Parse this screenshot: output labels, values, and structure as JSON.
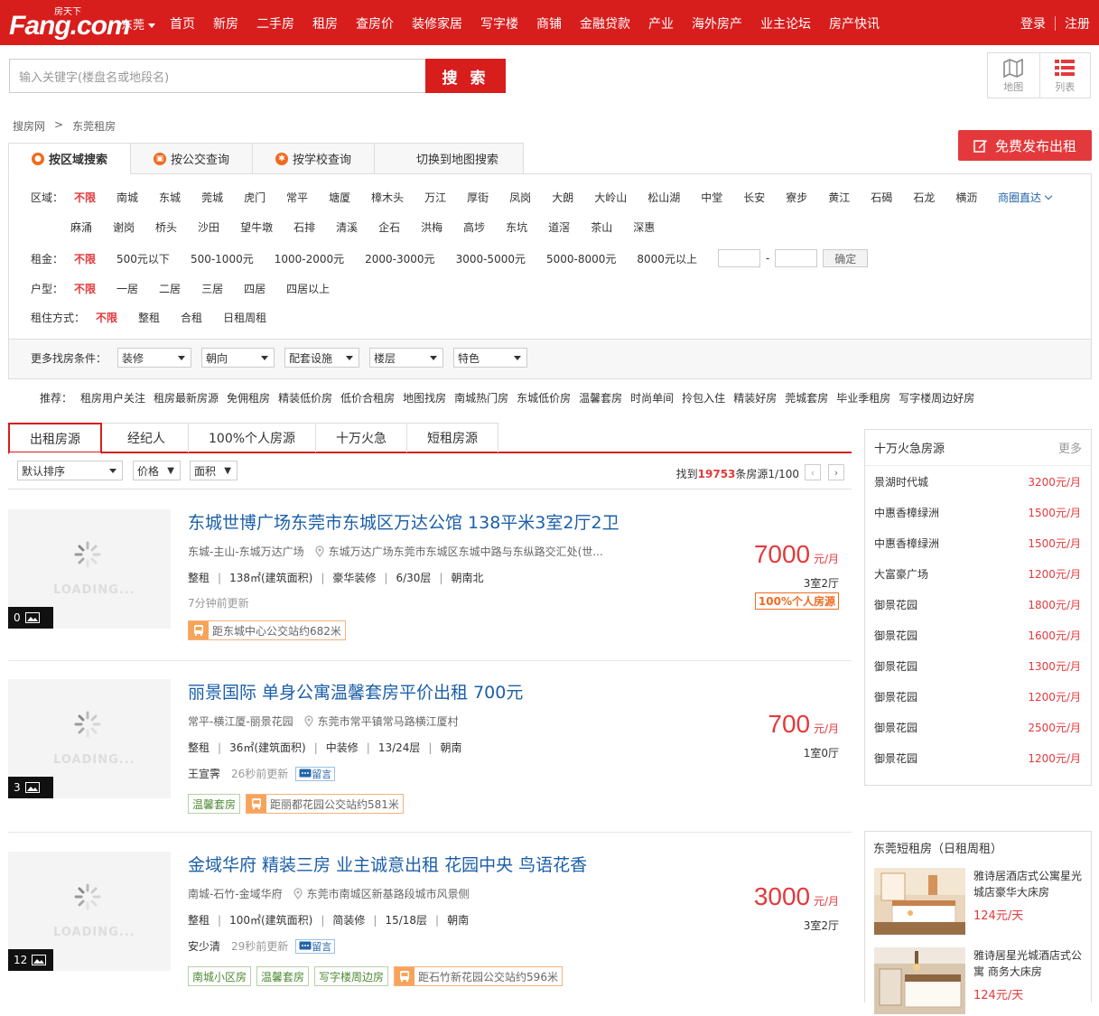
{
  "header": {
    "logo_text": "Fang.com",
    "logo_cn": "房天下",
    "city": "东莞",
    "nav": [
      "首页",
      "新房",
      "二手房",
      "租房",
      "查房价",
      "装修家居",
      "写字楼",
      "商铺",
      "金融贷款",
      "产业",
      "海外房产",
      "业主论坛",
      "房产快讯"
    ],
    "login": "登录",
    "register": "注册"
  },
  "search": {
    "placeholder": "输入关键字(楼盘名或地段名)",
    "button": "搜 索"
  },
  "view_switch": {
    "map": "地图",
    "list": "列表"
  },
  "breadcrumb": [
    "搜房网",
    ">",
    "东莞租房"
  ],
  "publish_button": "免费发布出租",
  "filter_tabs": [
    "按区域搜索",
    "按公交查询",
    "按学校查询",
    "切换到地图搜索"
  ],
  "filters": {
    "area_label": "区域：",
    "area_row1": [
      "不限",
      "南城",
      "东城",
      "莞城",
      "虎门",
      "常平",
      "塘厦",
      "樟木头",
      "万江",
      "厚街",
      "凤岗",
      "大朗",
      "大岭山",
      "松山湖",
      "中堂",
      "长安",
      "寮步",
      "黄江",
      "石碣",
      "石龙",
      "横沥"
    ],
    "area_row2": [
      "麻涌",
      "谢岗",
      "桥头",
      "沙田",
      "望牛墩",
      "石排",
      "清溪",
      "企石",
      "洪梅",
      "高埗",
      "东坑",
      "道滘",
      "茶山",
      "深惠"
    ],
    "more": "商圈直达",
    "rent_label": "租金：",
    "rent": [
      "不限",
      "500元以下",
      "500-1000元",
      "1000-2000元",
      "2000-3000元",
      "3000-5000元",
      "5000-8000元",
      "8000元以上"
    ],
    "rent_dash": "-",
    "confirm": "确定",
    "layout_label": "户型：",
    "layout": [
      "不限",
      "一居",
      "二居",
      "三居",
      "四居",
      "四居以上"
    ],
    "mode_label": "租住方式：",
    "mode": [
      "不限",
      "整租",
      "合租",
      "日租周租"
    ],
    "more_label": "更多找房条件：",
    "dropdowns": [
      "装修",
      "朝向",
      "配套设施",
      "楼层",
      "特色"
    ]
  },
  "recommend": {
    "label": "推荐：",
    "items": [
      "租房用户关注",
      "租房最新房源",
      "免佣租房",
      "精装低价房",
      "低价合租房",
      "地图找房",
      "南城热门房",
      "东城低价房",
      "温馨套房",
      "时尚单间",
      "拎包入住",
      "精装好房",
      "莞城套房",
      "毕业季租房",
      "写字楼周边好房"
    ]
  },
  "list_tabs": [
    "出租房源",
    "经纪人",
    "100%个人房源",
    "十万火急",
    "短租房源"
  ],
  "sort": {
    "default": "默认排序",
    "price": "价格",
    "area": "面积",
    "found_prefix": "找到",
    "found_count": "19753",
    "found_suffix": "条房源1/100"
  },
  "listings": [
    {
      "title": "东城世博广场东莞市东城区万达公馆 138平米3室2厅2卫",
      "location": "东城-主山-东城万达广场",
      "address": "东城万达广场东莞市东城区东城中路与东纵路交汇处(世...",
      "details": [
        "整租",
        "138㎡(建筑面积)",
        "豪华装修",
        "6/30层",
        "朝南北"
      ],
      "agent": "",
      "updated": "7分钟前更新",
      "tags": [],
      "bus": "距东城中心公交站约682米",
      "price": "7000",
      "unit": "元/月",
      "rooms": "3室2厅",
      "badge": "100%个人房源",
      "photos": "0",
      "message": ""
    },
    {
      "title": "丽景国际 单身公寓温馨套房平价出租 700元",
      "location": "常平-横江厦-丽景花园",
      "address": "东莞市常平镇常马路横江厦村",
      "details": [
        "整租",
        "36㎡(建筑面积)",
        "中装修",
        "13/24层",
        "朝南"
      ],
      "agent": "王宣霁",
      "updated": "26秒前更新",
      "tags": [
        "温馨套房"
      ],
      "bus": "距丽都花园公交站约581米",
      "price": "700",
      "unit": "元/月",
      "rooms": "1室0厅",
      "badge": "",
      "photos": "3",
      "message": "留言"
    },
    {
      "title": "金域华府 精装三房 业主诚意出租 花园中央 鸟语花香",
      "location": "南城-石竹-金域华府",
      "address": "东莞市南城区新基路段城市风景侧",
      "details": [
        "整租",
        "100㎡(建筑面积)",
        "简装修",
        "15/18层",
        "朝南"
      ],
      "agent": "安少清",
      "updated": "29秒前更新",
      "tags": [
        "南城小区房",
        "温馨套房",
        "写字楼周边房"
      ],
      "bus": "距石竹新花园公交站约596米",
      "price": "3000",
      "unit": "元/月",
      "rooms": "3室2厅",
      "badge": "",
      "photos": "12",
      "message": "留言"
    }
  ],
  "loading_text": "LOADING...",
  "urgent": {
    "title": "十万火急房源",
    "more": "更多",
    "items": [
      {
        "name": "景湖时代城",
        "price": "3200元/月"
      },
      {
        "name": "中惠香樟绿洲",
        "price": "1500元/月"
      },
      {
        "name": "中惠香樟绿洲",
        "price": "1500元/月"
      },
      {
        "name": "大富豪广场",
        "price": "1200元/月"
      },
      {
        "name": "御景花园",
        "price": "1800元/月"
      },
      {
        "name": "御景花园",
        "price": "1600元/月"
      },
      {
        "name": "御景花园",
        "price": "1300元/月"
      },
      {
        "name": "御景花园",
        "price": "1200元/月"
      },
      {
        "name": "御景花园",
        "price": "2500元/月"
      },
      {
        "name": "御景花园",
        "price": "1200元/月"
      }
    ]
  },
  "short_rent": {
    "title": "东莞短租房（日租周租）",
    "items": [
      {
        "name": "雅诗居酒店式公寓星光城店豪华大床房",
        "price": "124元/天"
      },
      {
        "name": "雅诗居星光城酒店式公寓 商务大床房",
        "price": "124元/天"
      }
    ]
  },
  "colors": {
    "brand_red": "#d81d1d",
    "price_red": "#e4393c",
    "link_blue": "#1b5fa8"
  }
}
